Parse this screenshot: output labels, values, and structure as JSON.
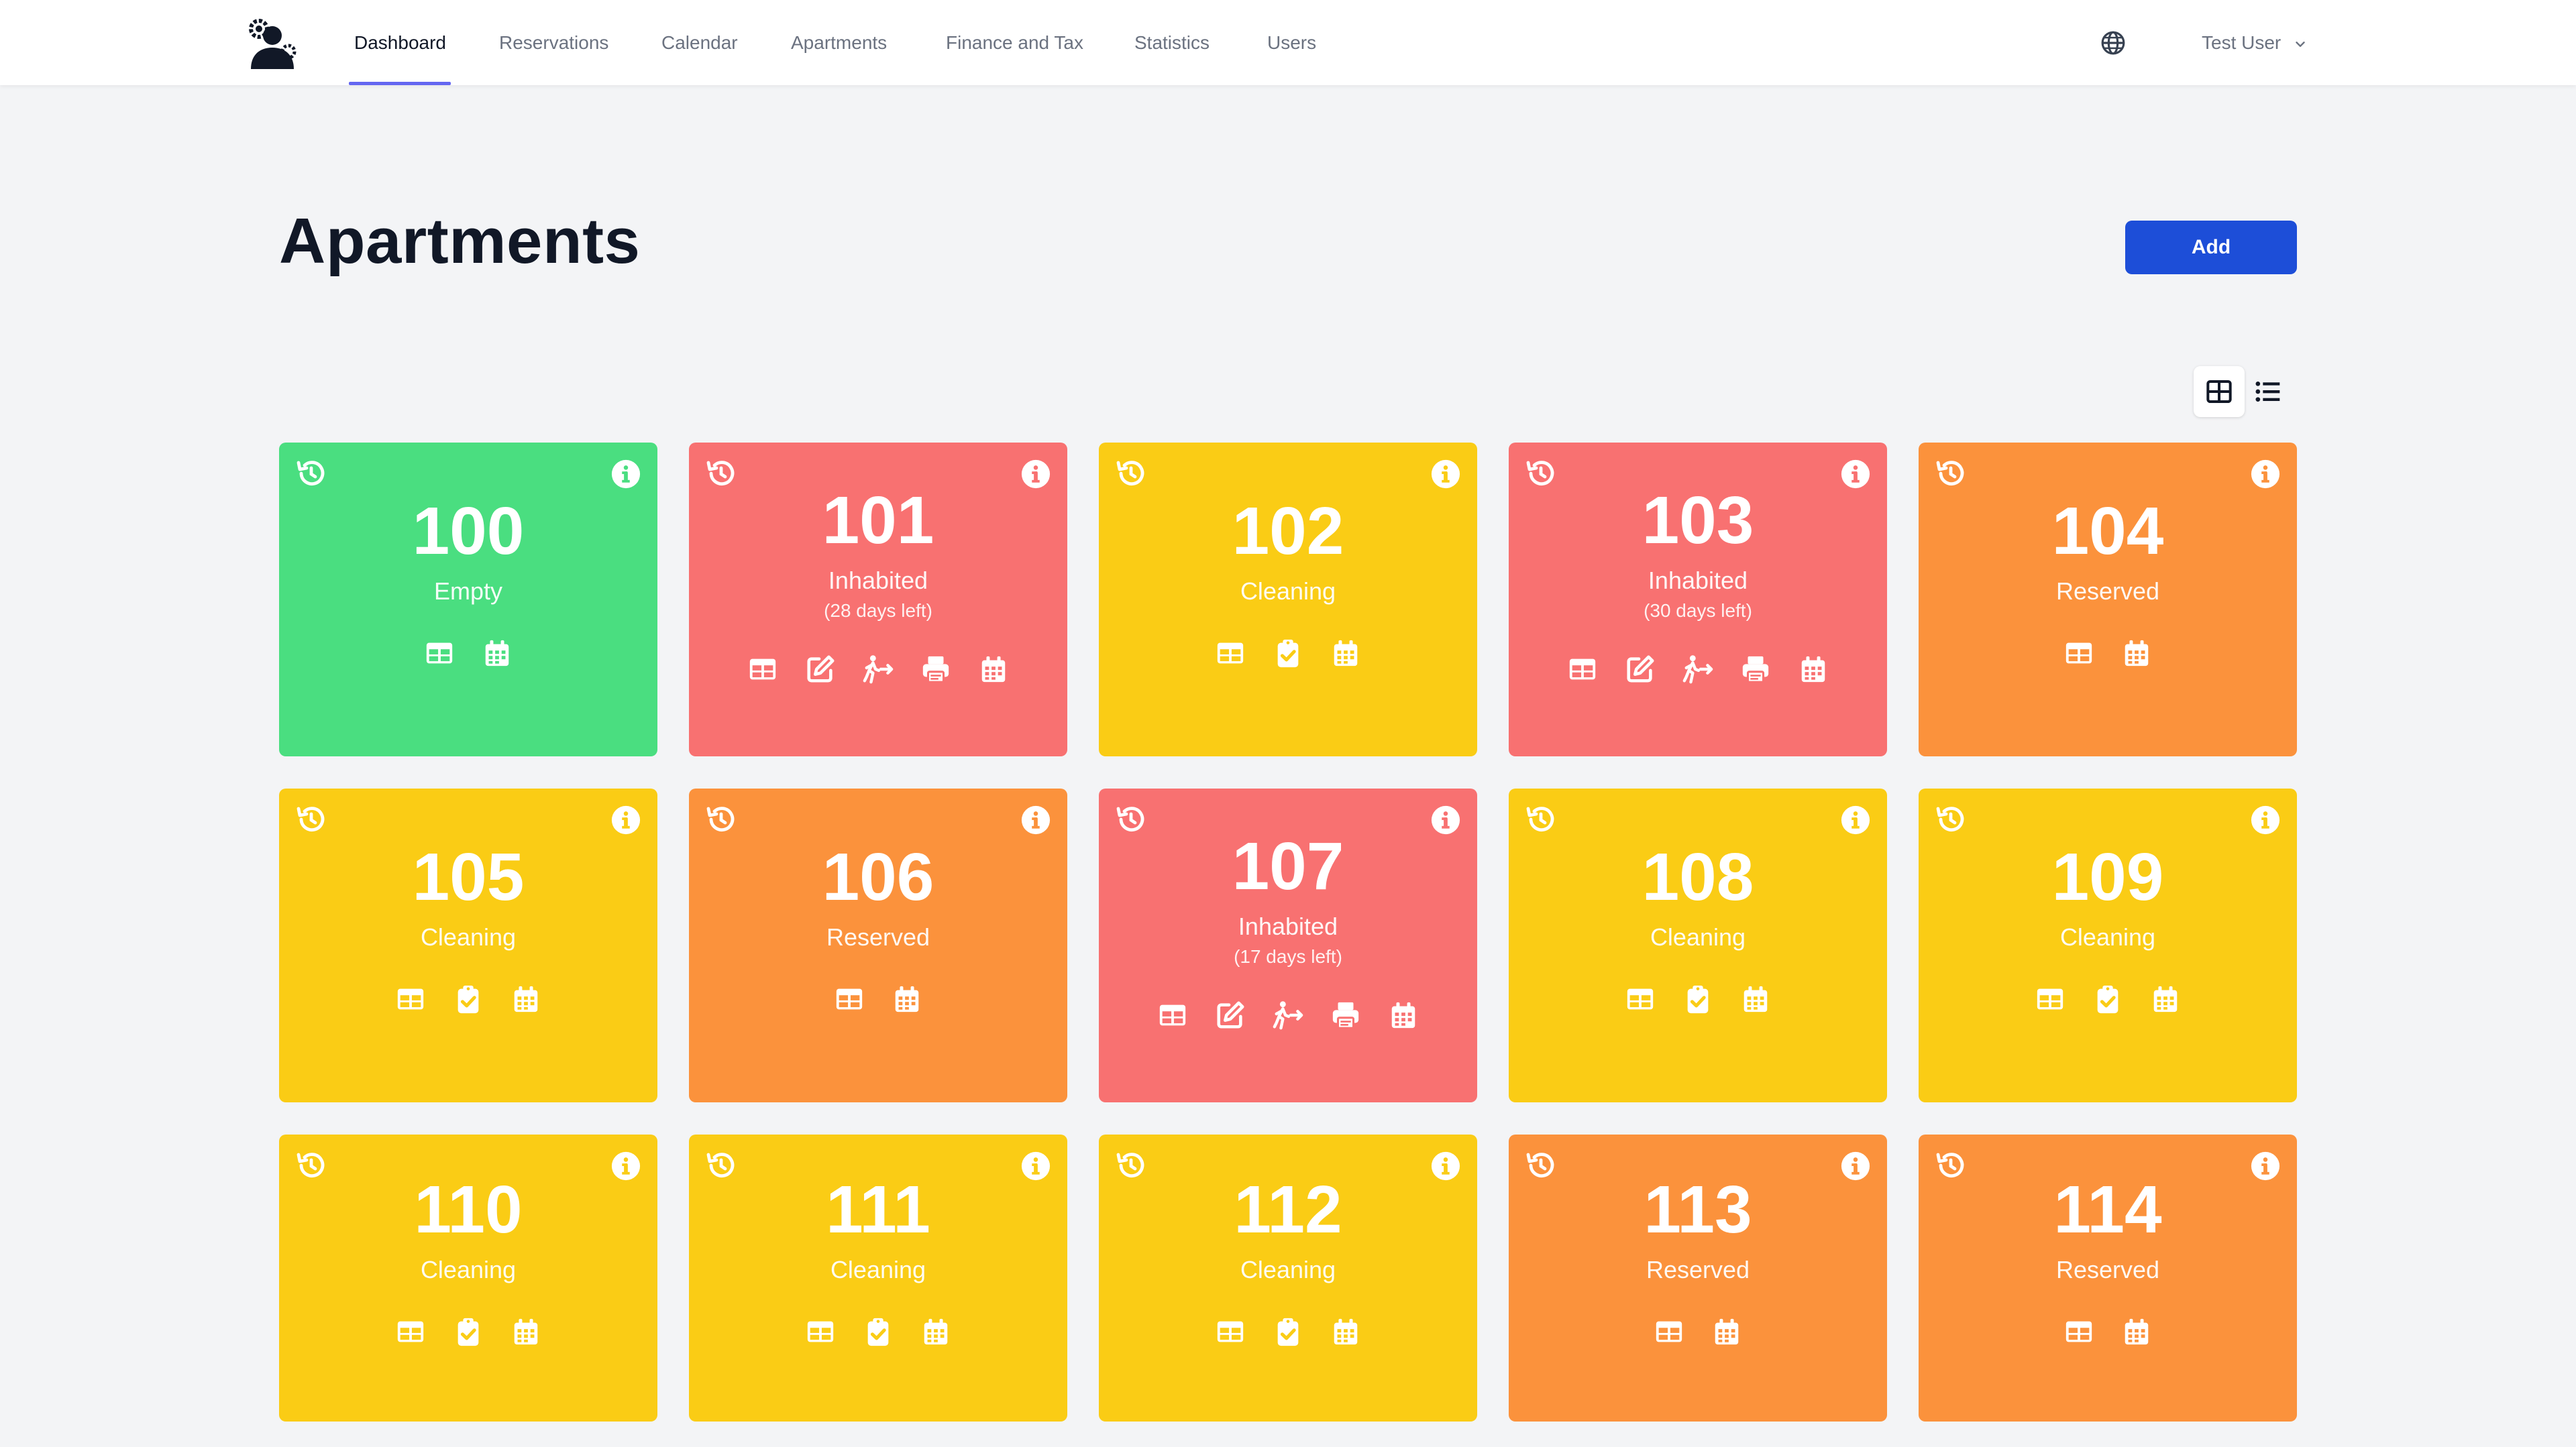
{
  "nav": {
    "items": [
      {
        "label": "Dashboard",
        "active": true
      },
      {
        "label": "Reservations",
        "active": false
      },
      {
        "label": "Calendar",
        "active": false
      },
      {
        "label": "Apartments",
        "active": false
      },
      {
        "label": "Finance and Tax",
        "active": false
      },
      {
        "label": "Statistics",
        "active": false
      },
      {
        "label": "Users",
        "active": false
      }
    ],
    "user": "Test User",
    "accent": "#6366f1"
  },
  "page": {
    "title": "Apartments",
    "add_label": "Add",
    "add_color": "#1d4ed8"
  },
  "colors": {
    "Empty": "#4ade80",
    "Inhabited": "#f87171",
    "Cleaning": "#facc15",
    "Reserved": "#fb923c"
  },
  "apartments": [
    {
      "number": "100",
      "status": "Empty",
      "detail": "",
      "actions": [
        "table-icon",
        "calendar-icon"
      ]
    },
    {
      "number": "101",
      "status": "Inhabited",
      "detail": "(28 days left)",
      "actions": [
        "table-icon",
        "edit-icon",
        "checkout-icon",
        "print-icon",
        "calendar-icon"
      ]
    },
    {
      "number": "102",
      "status": "Cleaning",
      "detail": "",
      "actions": [
        "table-icon",
        "clipboard-check-icon",
        "calendar-icon"
      ]
    },
    {
      "number": "103",
      "status": "Inhabited",
      "detail": "(30 days left)",
      "actions": [
        "table-icon",
        "edit-icon",
        "checkout-icon",
        "print-icon",
        "calendar-icon"
      ]
    },
    {
      "number": "104",
      "status": "Reserved",
      "detail": "",
      "actions": [
        "table-icon",
        "calendar-icon"
      ]
    },
    {
      "number": "105",
      "status": "Cleaning",
      "detail": "",
      "actions": [
        "table-icon",
        "clipboard-check-icon",
        "calendar-icon"
      ]
    },
    {
      "number": "106",
      "status": "Reserved",
      "detail": "",
      "actions": [
        "table-icon",
        "calendar-icon"
      ]
    },
    {
      "number": "107",
      "status": "Inhabited",
      "detail": "(17 days left)",
      "actions": [
        "table-icon",
        "edit-icon",
        "checkout-icon",
        "print-icon",
        "calendar-icon"
      ]
    },
    {
      "number": "108",
      "status": "Cleaning",
      "detail": "",
      "actions": [
        "table-icon",
        "clipboard-check-icon",
        "calendar-icon"
      ]
    },
    {
      "number": "109",
      "status": "Cleaning",
      "detail": "",
      "actions": [
        "table-icon",
        "clipboard-check-icon",
        "calendar-icon"
      ]
    },
    {
      "number": "110",
      "status": "Cleaning",
      "detail": "",
      "actions": [
        "table-icon",
        "clipboard-check-icon",
        "calendar-icon"
      ]
    },
    {
      "number": "111",
      "status": "Cleaning",
      "detail": "",
      "actions": [
        "table-icon",
        "clipboard-check-icon",
        "calendar-icon"
      ]
    },
    {
      "number": "112",
      "status": "Cleaning",
      "detail": "",
      "actions": [
        "table-icon",
        "clipboard-check-icon",
        "calendar-icon"
      ]
    },
    {
      "number": "113",
      "status": "Reserved",
      "detail": "",
      "actions": [
        "table-icon",
        "calendar-icon"
      ]
    },
    {
      "number": "114",
      "status": "Reserved",
      "detail": "",
      "actions": [
        "table-icon",
        "calendar-icon"
      ]
    }
  ]
}
